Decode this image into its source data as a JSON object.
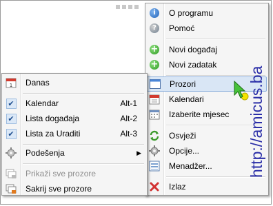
{
  "right_menu": {
    "items": [
      {
        "label": "O programu",
        "icon": "info-icon"
      },
      {
        "label": "Pomoć",
        "icon": "help-icon"
      },
      {
        "label": "Novi događaj",
        "icon": "add-event-icon"
      },
      {
        "label": "Novi zadatak",
        "icon": "add-task-icon"
      },
      {
        "label": "Prozori",
        "icon": "window-icon"
      },
      {
        "label": "Kalendari",
        "icon": "calendar-icon"
      },
      {
        "label": "Izaberite mjesec",
        "icon": "month-icon"
      },
      {
        "label": "Osvježi",
        "icon": "refresh-icon"
      },
      {
        "label": "Opcije...",
        "icon": "options-icon"
      },
      {
        "label": "Menadžer...",
        "icon": "manager-icon"
      },
      {
        "label": "Izlaz",
        "icon": "exit-icon"
      }
    ]
  },
  "left_menu": {
    "items": [
      {
        "label": "Danas",
        "icon": "today-calendar-icon"
      },
      {
        "label": "Kalendar",
        "shortcut": "Alt-1",
        "checked": true
      },
      {
        "label": "Lista događaja",
        "shortcut": "Alt-2",
        "checked": true
      },
      {
        "label": "Lista za Uraditi",
        "shortcut": "Alt-3",
        "checked": true
      },
      {
        "label": "Podešenja",
        "icon": "gear-icon",
        "submenu": true
      },
      {
        "label": "Prikaži sve prozore",
        "icon": "show-windows-icon",
        "disabled": true
      },
      {
        "label": "Sakrij sve prozore",
        "icon": "hide-windows-icon"
      }
    ]
  },
  "watermark": {
    "text": "http://amicus.ba"
  },
  "colors": {
    "highlight": "#d9e6f5",
    "watermark": "#2b2fa8"
  }
}
